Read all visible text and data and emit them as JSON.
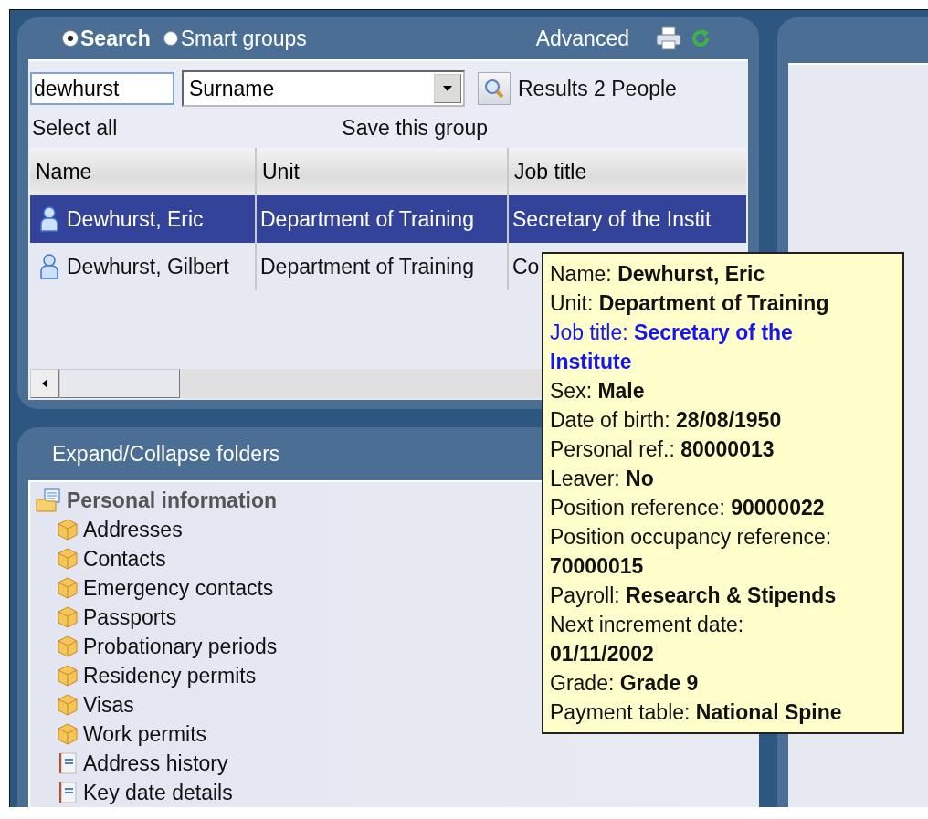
{
  "search_panel": {
    "modes": [
      {
        "label": "Search",
        "selected": true
      },
      {
        "label": "Smart groups",
        "selected": false
      }
    ],
    "advanced_link": "Advanced",
    "search_field": {
      "value": "dewhurst"
    },
    "field_dropdown": {
      "value": "Surname"
    },
    "results": "Results 2 People",
    "select_all": "Select all",
    "save_group": "Save this group"
  },
  "table": {
    "columns": [
      "Name",
      "Unit",
      "Job title"
    ],
    "rows": [
      {
        "selected": true,
        "cells": [
          "Dewhurst, Eric",
          "Department of Training",
          "Secretary of the Instit"
        ]
      },
      {
        "selected": false,
        "cells": [
          "Dewhurst, Gilbert",
          "Department of Training",
          "Co"
        ]
      }
    ]
  },
  "tooltip": {
    "lines": [
      {
        "text": "Name: **Dewhurst, Eric**",
        "highlighted": false
      },
      {
        "text": "Unit: **Department of Training**",
        "highlighted": false
      },
      {
        "text": "Job title: **Secretary of the Institute**",
        "highlighted": true
      },
      {
        "text": "Sex: **Male**",
        "highlighted": false
      },
      {
        "text": "Date of birth: **28/08/1950**",
        "highlighted": false
      },
      {
        "text": "Personal ref.: **80000013**",
        "highlighted": false
      },
      {
        "text": "Leaver: **No**",
        "highlighted": false
      },
      {
        "text": "Position reference: **90000022**",
        "highlighted": false
      },
      {
        "text": "Position occupancy reference: **70000015**",
        "highlighted": false
      },
      {
        "text": "Payroll: **Research & Stipends**",
        "highlighted": false
      },
      {
        "text": "Next increment date: **01/11/2002**",
        "highlighted": false
      },
      {
        "text": "Grade: **Grade 9**",
        "highlighted": false
      },
      {
        "text": "Payment table: **National Spine**",
        "highlighted": false
      }
    ]
  },
  "folders_panel": {
    "title": "Expand/Collapse folders",
    "tree": [
      {
        "label": "Personal information",
        "kind": "folder",
        "children": [
          {
            "label": "Addresses",
            "kind": "table"
          },
          {
            "label": "Contacts",
            "kind": "table"
          },
          {
            "label": "Emergency contacts",
            "kind": "table"
          },
          {
            "label": "Passports",
            "kind": "table"
          },
          {
            "label": "Probationary periods",
            "kind": "table"
          },
          {
            "label": "Residency permits",
            "kind": "table"
          },
          {
            "label": "Visas",
            "kind": "table"
          },
          {
            "label": "Work permits",
            "kind": "table"
          },
          {
            "label": "Address history",
            "kind": "document"
          },
          {
            "label": "Key date details",
            "kind": "document"
          }
        ]
      }
    ]
  }
}
